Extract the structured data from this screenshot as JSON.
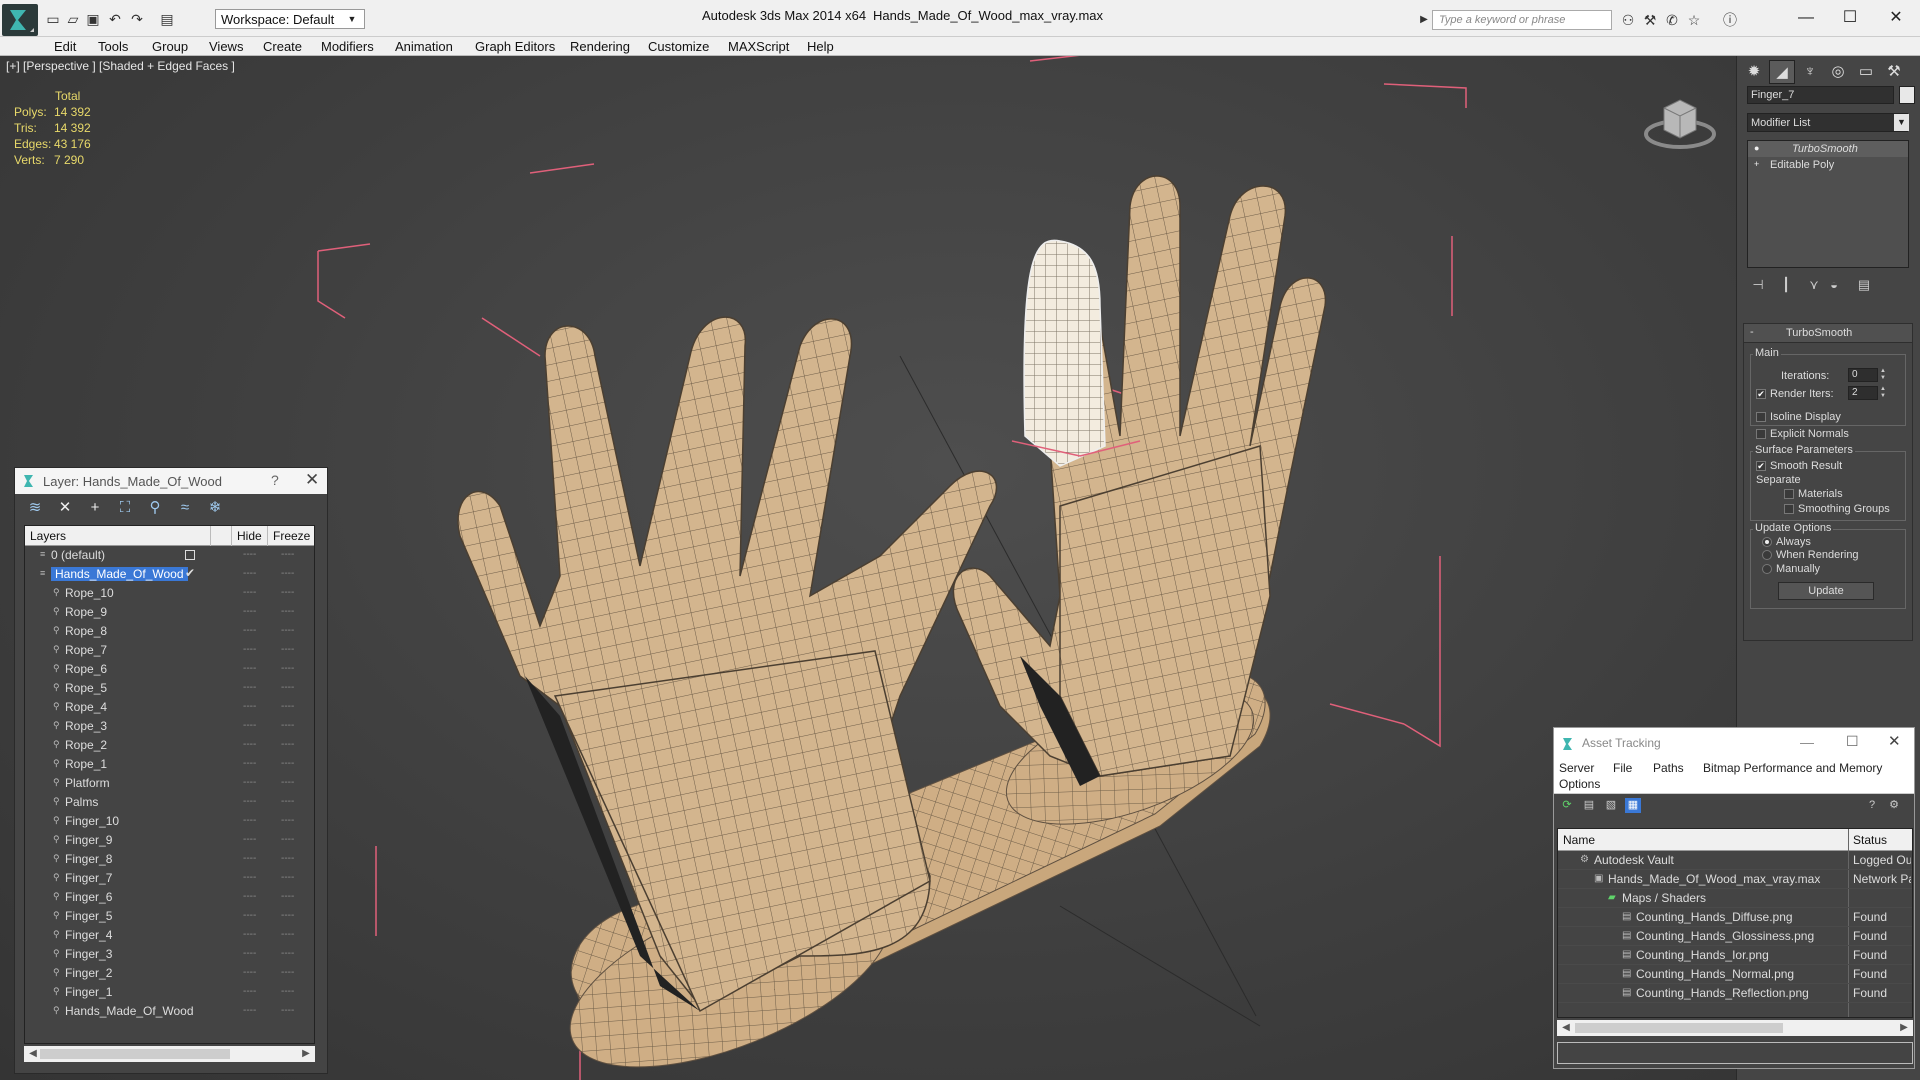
{
  "titlebar": {
    "workspace": "Workspace: Default",
    "app_title": "Autodesk 3ds Max  2014 x64",
    "file_title": "Hands_Made_Of_Wood_max_vray.max",
    "search_placeholder": "Type a keyword or phrase",
    "win_min": "—",
    "win_max": "☐",
    "win_close": "✕"
  },
  "menu": [
    "Edit",
    "Tools",
    "Group",
    "Views",
    "Create",
    "Modifiers",
    "Animation",
    "Graph Editors",
    "Rendering",
    "Customize",
    "MAXScript",
    "Help"
  ],
  "viewport": {
    "label": "[+] [Perspective ] [Shaded + Edged Faces ]",
    "stats_header": "Total",
    "stats": [
      {
        "label": "Polys:",
        "value": "14 392"
      },
      {
        "label": "Tris:",
        "value": "14 392"
      },
      {
        "label": "Edges:",
        "value": "43 176"
      },
      {
        "label": "Verts:",
        "value": "7 290"
      }
    ]
  },
  "layer_panel": {
    "title": "Layer: Hands_Made_Of_Wood",
    "help": "?",
    "close": "✕",
    "col_layers": "Layers",
    "col_hide": "Hide",
    "col_freeze": "Freeze",
    "rows": [
      "0 (default)",
      "Hands_Made_Of_Wood",
      "Rope_10",
      "Rope_9",
      "Rope_8",
      "Rope_7",
      "Rope_6",
      "Rope_5",
      "Rope_4",
      "Rope_3",
      "Rope_2",
      "Rope_1",
      "Platform",
      "Palms",
      "Finger_10",
      "Finger_9",
      "Finger_8",
      "Finger_7",
      "Finger_6",
      "Finger_5",
      "Finger_4",
      "Finger_3",
      "Finger_2",
      "Finger_1",
      "Hands_Made_Of_Wood"
    ],
    "selected_row": 1,
    "dash": "----"
  },
  "command_panel": {
    "object_name": "Finger_7",
    "modifier_list": "Modifier List",
    "stack": [
      "TurboSmooth",
      "Editable Poly"
    ],
    "rollout_title": "TurboSmooth",
    "main_group": "Main",
    "iterations_label": "Iterations:",
    "iterations_value": "0",
    "render_iters_label": "Render Iters:",
    "render_iters_value": "2",
    "render_iters_checked": true,
    "isoline_label": "Isoline Display",
    "explicit_label": "Explicit Normals",
    "surface_group": "Surface Parameters",
    "smooth_result_label": "Smooth Result",
    "smooth_result_checked": true,
    "separate_label": "Separate",
    "materials_label": "Materials",
    "smoothing_groups_label": "Smoothing Groups",
    "update_group": "Update Options",
    "always_label": "Always",
    "when_rendering_label": "When Rendering",
    "manually_label": "Manually",
    "update_button": "Update"
  },
  "asset_panel": {
    "title": "Asset Tracking",
    "menu": [
      "Server",
      "File",
      "Paths",
      "Bitmap Performance and Memory",
      "Options"
    ],
    "col_name": "Name",
    "col_status": "Status",
    "rows": [
      {
        "name": "Autodesk Vault",
        "status": "Logged Out",
        "indent": 0
      },
      {
        "name": "Hands_Made_Of_Wood_max_vray.max",
        "status": "Network Path",
        "indent": 1
      },
      {
        "name": "Maps / Shaders",
        "status": "",
        "indent": 2
      },
      {
        "name": "Counting_Hands_Diffuse.png",
        "status": "Found",
        "indent": 3
      },
      {
        "name": "Counting_Hands_Glossiness.png",
        "status": "Found",
        "indent": 3
      },
      {
        "name": "Counting_Hands_Ior.png",
        "status": "Found",
        "indent": 3
      },
      {
        "name": "Counting_Hands_Normal.png",
        "status": "Found",
        "indent": 3
      },
      {
        "name": "Counting_Hands_Reflection.png",
        "status": "Found",
        "indent": 3
      }
    ]
  },
  "colors": {
    "viewport_bg": "#444444",
    "stats_text": "#e8d96a",
    "selection": "#3a78d6",
    "bbox": "#e0607a",
    "wood": "#d3b58e"
  }
}
